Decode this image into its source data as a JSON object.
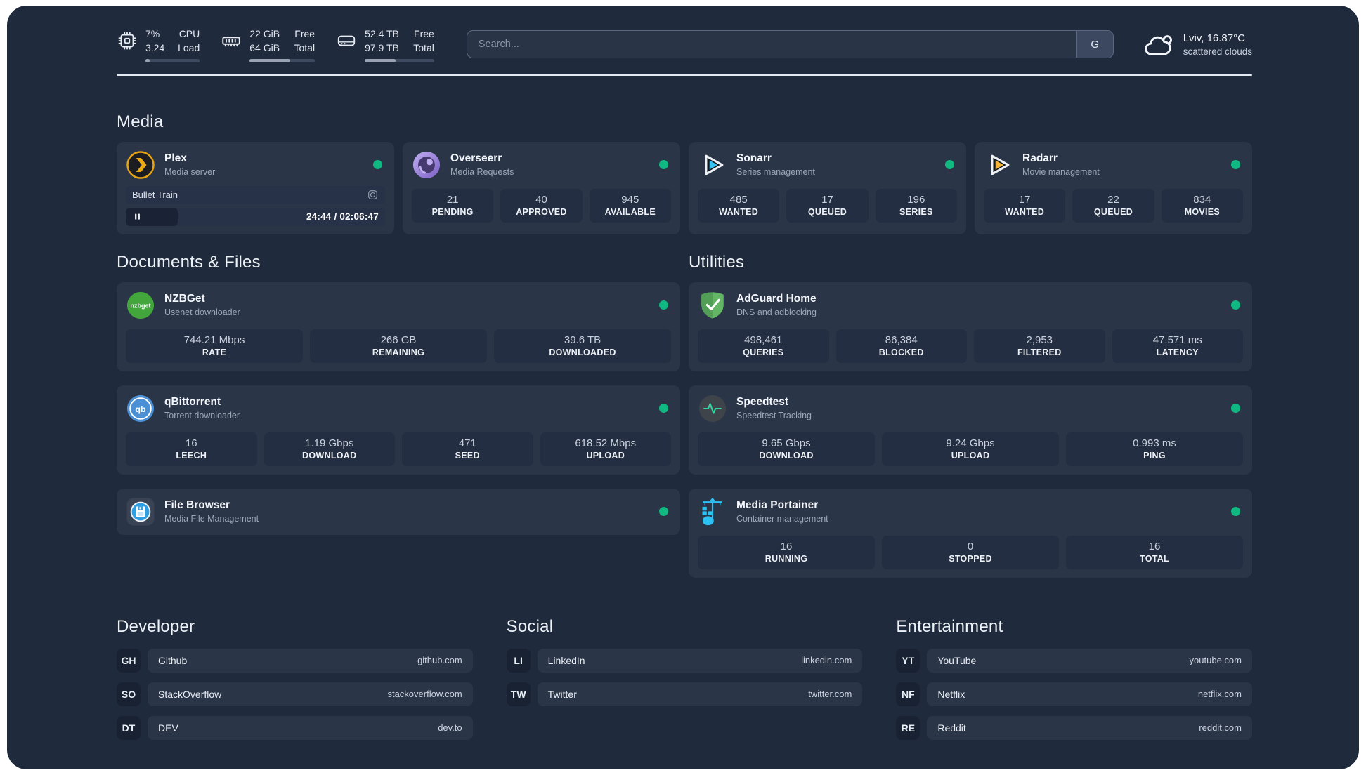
{
  "theme": {
    "background": "#202a3d",
    "card": "#2b3548",
    "stat_box": "#242e42",
    "status_online": "#10b981",
    "plex_accent": "#e6a414",
    "sonarr_accent": "#38c1ee",
    "radarr_accent": "#f5b433"
  },
  "header": {
    "stats": [
      {
        "icon": "cpu-icon",
        "value1": "7%",
        "value2": "3.24",
        "label1": "CPU",
        "label2": "Load",
        "progress": 7
      },
      {
        "icon": "memory-icon",
        "value1": "22 GiB",
        "value2": "64 GiB",
        "label1": "Free",
        "label2": "Total",
        "progress": 62
      },
      {
        "icon": "disk-icon",
        "value1": "52.4 TB",
        "value2": "97.9 TB",
        "label1": "Free",
        "label2": "Total",
        "progress": 44
      }
    ],
    "search": {
      "placeholder": "Search...",
      "button_label": "G"
    },
    "weather": {
      "icon": "cloud-icon",
      "location_temp": "Lviv, 16.87°C",
      "condition": "scattered clouds"
    }
  },
  "sections": {
    "media": {
      "title": "Media",
      "apps": [
        {
          "icon": "plex-icon",
          "name": "Plex",
          "desc": "Media server",
          "online": true,
          "player": {
            "title": "Bullet Train",
            "time": "24:44 / 02:06:47",
            "progress": 20
          }
        },
        {
          "icon": "overseerr-icon",
          "name": "Overseerr",
          "desc": "Media Requests",
          "online": true,
          "stats": [
            {
              "value": "21",
              "label": "PENDING"
            },
            {
              "value": "40",
              "label": "APPROVED"
            },
            {
              "value": "945",
              "label": "AVAILABLE"
            }
          ]
        },
        {
          "icon": "sonarr-icon",
          "name": "Sonarr",
          "desc": "Series management",
          "online": true,
          "stats": [
            {
              "value": "485",
              "label": "WANTED"
            },
            {
              "value": "17",
              "label": "QUEUED"
            },
            {
              "value": "196",
              "label": "SERIES"
            }
          ]
        },
        {
          "icon": "radarr-icon",
          "name": "Radarr",
          "desc": "Movie management",
          "online": true,
          "stats": [
            {
              "value": "17",
              "label": "WANTED"
            },
            {
              "value": "22",
              "label": "QUEUED"
            },
            {
              "value": "834",
              "label": "MOVIES"
            }
          ]
        }
      ]
    },
    "documents": {
      "title": "Documents & Files",
      "apps": [
        {
          "icon": "nzbget-icon",
          "name": "NZBGet",
          "desc": "Usenet downloader",
          "online": true,
          "stats": [
            {
              "value": "744.21 Mbps",
              "label": "RATE"
            },
            {
              "value": "266 GB",
              "label": "REMAINING"
            },
            {
              "value": "39.6 TB",
              "label": "DOWNLOADED"
            }
          ]
        },
        {
          "icon": "qbittorrent-icon",
          "name": "qBittorrent",
          "desc": "Torrent downloader",
          "online": true,
          "stats": [
            {
              "value": "16",
              "label": "LEECH"
            },
            {
              "value": "1.19 Gbps",
              "label": "DOWNLOAD"
            },
            {
              "value": "471",
              "label": "SEED"
            },
            {
              "value": "618.52 Mbps",
              "label": "UPLOAD"
            }
          ]
        },
        {
          "icon": "filebrowser-icon",
          "name": "File Browser",
          "desc": "Media File Management",
          "online": true,
          "stats": []
        }
      ]
    },
    "utilities": {
      "title": "Utilities",
      "apps": [
        {
          "icon": "adguard-icon",
          "name": "AdGuard Home",
          "desc": "DNS and adblocking",
          "online": true,
          "stats": [
            {
              "value": "498,461",
              "label": "QUERIES"
            },
            {
              "value": "86,384",
              "label": "BLOCKED"
            },
            {
              "value": "2,953",
              "label": "FILTERED"
            },
            {
              "value": "47.571 ms",
              "label": "LATENCY"
            }
          ]
        },
        {
          "icon": "speedtest-icon",
          "name": "Speedtest",
          "desc": "Speedtest Tracking",
          "online": true,
          "stats": [
            {
              "value": "9.65 Gbps",
              "label": "DOWNLOAD"
            },
            {
              "value": "9.24 Gbps",
              "label": "UPLOAD"
            },
            {
              "value": "0.993 ms",
              "label": "PING"
            }
          ]
        },
        {
          "icon": "portainer-icon",
          "name": "Media Portainer",
          "desc": "Container management",
          "online": true,
          "stats": [
            {
              "value": "16",
              "label": "RUNNING"
            },
            {
              "value": "0",
              "label": "STOPPED"
            },
            {
              "value": "16",
              "label": "TOTAL"
            }
          ]
        }
      ]
    }
  },
  "bookmarks": [
    {
      "title": "Developer",
      "links": [
        {
          "abbr": "GH",
          "name": "Github",
          "url": "github.com"
        },
        {
          "abbr": "SO",
          "name": "StackOverflow",
          "url": "stackoverflow.com"
        },
        {
          "abbr": "DT",
          "name": "DEV",
          "url": "dev.to"
        }
      ]
    },
    {
      "title": "Social",
      "links": [
        {
          "abbr": "LI",
          "name": "LinkedIn",
          "url": "linkedin.com"
        },
        {
          "abbr": "TW",
          "name": "Twitter",
          "url": "twitter.com"
        }
      ]
    },
    {
      "title": "Entertainment",
      "links": [
        {
          "abbr": "YT",
          "name": "YouTube",
          "url": "youtube.com"
        },
        {
          "abbr": "NF",
          "name": "Netflix",
          "url": "netflix.com"
        },
        {
          "abbr": "RE",
          "name": "Reddit",
          "url": "reddit.com"
        }
      ]
    }
  ]
}
